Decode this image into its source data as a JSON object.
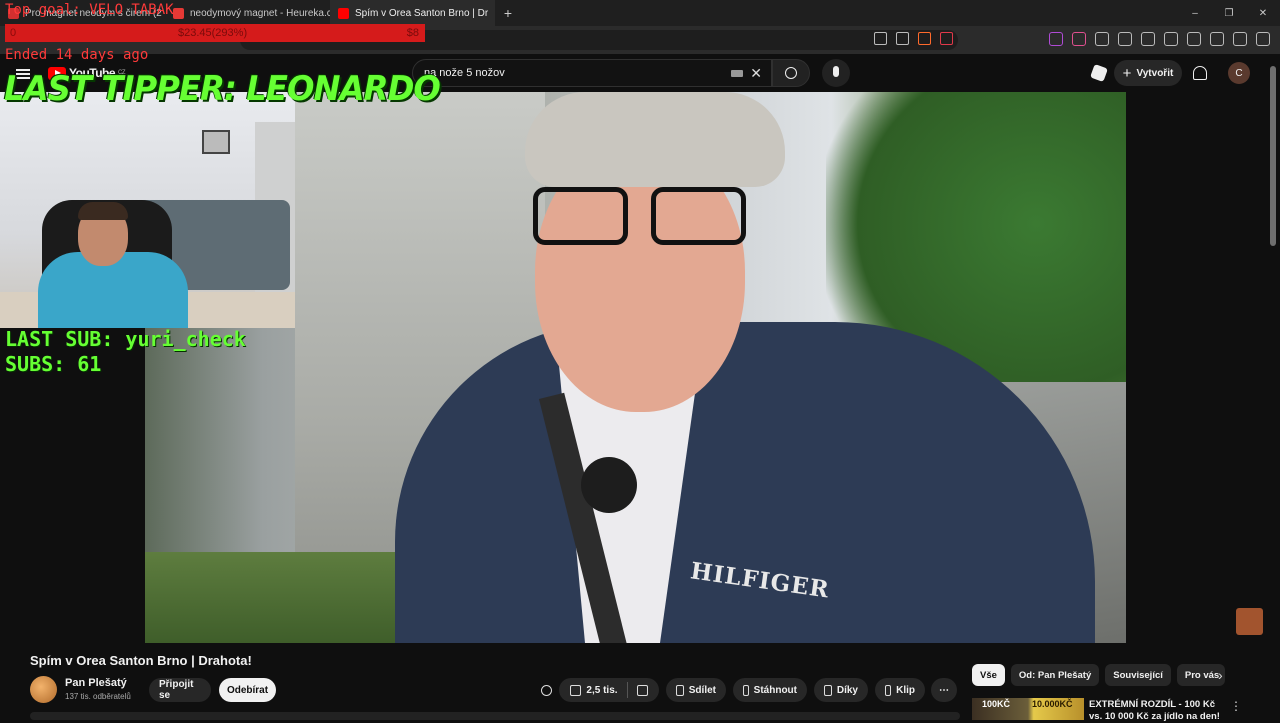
{
  "browser": {
    "tabs": [
      {
        "label": "Top goal: VELO TABAK",
        "active": false,
        "color": "#d32f2f"
      },
      {
        "label": "neodymový magnet - Heureka.cz",
        "active": false,
        "color": "#e53935"
      },
      {
        "label": "Spím v Orea Santon Brno | Dr",
        "active": true,
        "color": "#ff0000"
      }
    ],
    "tab_overlap_text": "Pro magnet neodym s čirem (2",
    "new_tab_label": "+",
    "window_controls": [
      "–",
      "❐",
      "✕"
    ]
  },
  "overlay": {
    "goal_title": "Top goal: VELO TABAK",
    "goal_start": "0",
    "goal_progress": "$23.45(293%)",
    "goal_progress_fraction": 2.93,
    "goal_end": "$8",
    "ended": "Ended 14 days ago",
    "last_tipper": "LAST TIPPER: LEONARDO",
    "last_sub": "LAST SUB: yuri_check",
    "subs": "SUBS: 61"
  },
  "youtube": {
    "logo_text": "YouTube",
    "logo_country": "CZ",
    "search_value": "na nože 5 nožov",
    "create_label": "Vytvořit",
    "account_initial": "C",
    "accent": "#ff0000"
  },
  "video": {
    "title": "Spím v Orea Santon Brno | Drahota!",
    "shirt_brand": "HILFIGER",
    "channel_name": "Pan Plešatý",
    "channel_subs": "137 tis. odběratelů",
    "join_label": "Připojit se",
    "subscribe_label": "Odebírat",
    "like_count": "2,5 tis.",
    "share_label": "Sdílet",
    "download_label": "Stáhnout",
    "thanks_label": "Díky",
    "clip_label": "Klip",
    "more_label": "⋯"
  },
  "sidebar": {
    "chips": [
      "Vše",
      "Od: Pan Plešatý",
      "Související",
      "Pro vás"
    ],
    "recommend": {
      "thumb_left": "100KČ",
      "thumb_right": "10.000KČ",
      "title": "EXTRÉMNÍ ROZDÍL - 100 Kč vs. 10 000 Kč za jídlo na den!"
    }
  }
}
